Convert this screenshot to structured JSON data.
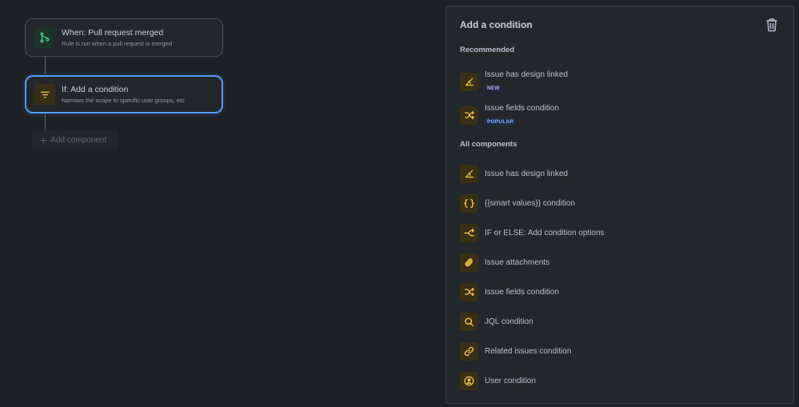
{
  "flow": {
    "trigger": {
      "title": "When: Pull request merged",
      "subtitle": "Rule is run when a pull request is merged",
      "icon": "branch-merge-icon"
    },
    "condition": {
      "title": "If: Add a condition",
      "subtitle": "Narrows the scope to specific user groups, etc",
      "icon": "filter-icon"
    },
    "add_component_label": "Add component"
  },
  "panel": {
    "title": "Add a condition",
    "recommended_label": "Recommended",
    "recommended": [
      {
        "label": "Issue has design linked",
        "badge": "NEW",
        "icon": "design-pen-icon"
      },
      {
        "label": "Issue fields condition",
        "badge": "POPULAR",
        "icon": "shuffle-icon"
      }
    ],
    "all_label": "All components",
    "all": [
      {
        "label": "Issue has design linked",
        "icon": "design-pen-icon"
      },
      {
        "label": "{{smart values}} condition",
        "icon": "curly-braces-icon"
      },
      {
        "label": "IF or ELSE: Add condition options",
        "icon": "branch-icon"
      },
      {
        "label": "Issue attachments",
        "icon": "paperclip-icon"
      },
      {
        "label": "Issue fields condition",
        "icon": "shuffle-icon"
      },
      {
        "label": "JQL condition",
        "icon": "search-icon"
      },
      {
        "label": "Related issues condition",
        "icon": "link-icon"
      },
      {
        "label": "User condition",
        "icon": "user-icon"
      }
    ]
  },
  "colors": {
    "background": "#1d2125",
    "panel": "#22272b",
    "accent": "#579dff",
    "icon_amber": "#f5cd47",
    "icon_green": "#4bce97"
  }
}
